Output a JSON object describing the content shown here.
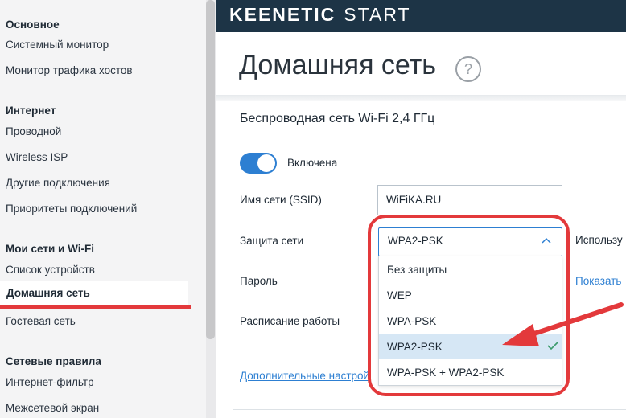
{
  "sidebar": {
    "groups": [
      {
        "title": "Основное",
        "items": [
          "Системный монитор",
          "Монитор трафика хостов"
        ]
      },
      {
        "title": "Интернет",
        "items": [
          "Проводной",
          "Wireless ISP",
          "Другие подключения",
          "Приоритеты подключений"
        ]
      },
      {
        "title": "Мои сети и Wi-Fi",
        "items": [
          "Список устройств",
          "Домашняя сеть",
          "Гостевая сеть"
        ]
      },
      {
        "title": "Сетевые правила",
        "items": [
          "Интернет-фильтр",
          "Межсетевой экран"
        ]
      }
    ],
    "active_item": "Домашняя сеть"
  },
  "header": {
    "brand": "KEENETIC",
    "product": "START"
  },
  "page": {
    "title": "Домашняя сеть",
    "help": "?"
  },
  "wifi": {
    "section_title": "Беспроводная сеть Wi-Fi 2,4 ГГц",
    "enabled_label": "Включена",
    "enabled": true,
    "ssid_label": "Имя сети (SSID)",
    "ssid_value": "WiFiKA.RU",
    "security_label": "Защита сети",
    "security_value": "WPA2-PSK",
    "security_options": [
      "Без защиты",
      "WEP",
      "WPA-PSK",
      "WPA2-PSK",
      "WPA-PSK + WPA2-PSK"
    ],
    "selected_index": 3,
    "password_label": "Пароль",
    "schedule_label": "Расписание работы",
    "use_text": "Использу",
    "show_link": "Показать",
    "advanced_link": "Дополнительные настрой"
  },
  "colors": {
    "accent": "#2d7fd2",
    "header_bg": "#1d3446",
    "annotation_red": "#e3393b",
    "check_green": "#3b9b6c"
  }
}
